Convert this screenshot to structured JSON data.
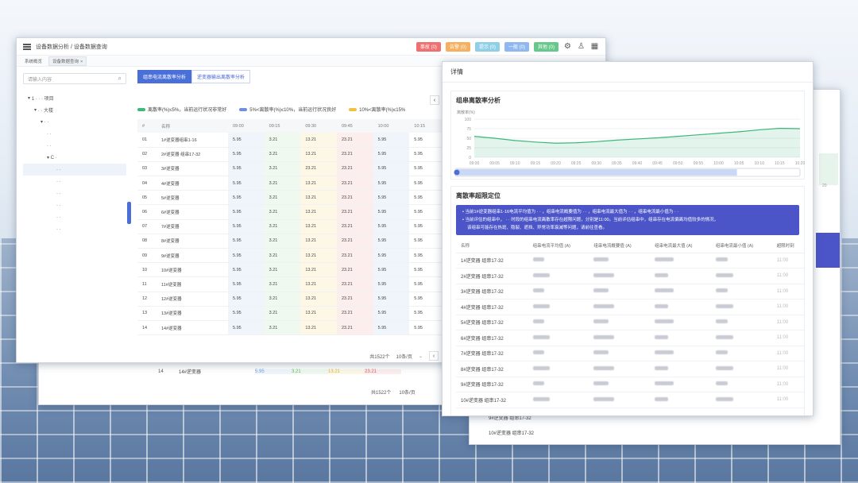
{
  "main": {
    "breadcrumb": "设备数据分析 / 设备数据查询",
    "tabs": [
      {
        "label": "系统概览"
      },
      {
        "label": "设备数据查询"
      }
    ],
    "status_chips": [
      {
        "label": "事故 (0)",
        "color": "#f07070"
      },
      {
        "label": "告警 (0)",
        "color": "#f5b060"
      },
      {
        "label": "提示 (0)",
        "color": "#8fd0e8"
      },
      {
        "label": "一般 (0)",
        "color": "#8fb8f0"
      },
      {
        "label": "其他 (0)",
        "color": "#66c88a"
      }
    ],
    "header_icons": [
      "settings-icon",
      "user-icon",
      "grid-icon"
    ],
    "search_placeholder": "请输入内容",
    "tree": [
      {
        "label": "1 · · · 项目",
        "indent": 0
      },
      {
        "label": "· · 大楼",
        "indent": 1
      },
      {
        "label": "· ·",
        "indent": 2
      },
      {
        "label": "· ·",
        "indent": 3
      },
      {
        "label": "· ·",
        "indent": 3
      },
      {
        "label": "C ·",
        "indent": 3
      },
      {
        "label": "· ·",
        "indent": 4
      },
      {
        "label": "· ·",
        "indent": 4
      },
      {
        "label": "· ·",
        "indent": 4
      },
      {
        "label": "· ·",
        "indent": 4
      },
      {
        "label": "· ·",
        "indent": 4
      },
      {
        "label": "· ·",
        "indent": 4
      }
    ],
    "content_tabs": [
      {
        "label": "组串电流离散率分析"
      },
      {
        "label": "逆变器输出离散率分析"
      }
    ],
    "legend": [
      {
        "label": "离散率(%)≤5%，当前运行状况非常好",
        "color": "#3cb878"
      },
      {
        "label": "5%<离散率(%)≤10%，当前运行状况良好",
        "color": "#6d8fe0"
      },
      {
        "label": "10%<离散率(%)≤15%",
        "color": "#f0c040"
      }
    ],
    "columns": [
      "#",
      "名称",
      "09:00",
      "09:15",
      "09:30",
      "09:45",
      "10:00",
      "10:15"
    ],
    "rows": [
      {
        "idx": "01",
        "name": "1#逆变器组串1-16",
        "v": [
          "5.95",
          "3.21",
          "13.21",
          "23.21",
          "5.95",
          "5.95"
        ]
      },
      {
        "idx": "02",
        "name": "2#逆变器 组串17-32",
        "v": [
          "5.95",
          "3.21",
          "13.21",
          "23.21",
          "5.95",
          "5.95"
        ]
      },
      {
        "idx": "03",
        "name": "3#逆变器",
        "v": [
          "5.95",
          "3.21",
          "23.21",
          "23.21",
          "5.95",
          "5.95"
        ]
      },
      {
        "idx": "04",
        "name": "4#逆变器",
        "v": [
          "5.95",
          "3.21",
          "13.21",
          "23.21",
          "5.95",
          "5.95"
        ]
      },
      {
        "idx": "05",
        "name": "5#逆变器",
        "v": [
          "5.95",
          "3.21",
          "13.21",
          "23.21",
          "5.95",
          "5.95"
        ]
      },
      {
        "idx": "06",
        "name": "6#逆变器",
        "v": [
          "5.95",
          "3.21",
          "13.21",
          "23.21",
          "5.95",
          "5.95"
        ]
      },
      {
        "idx": "07",
        "name": "7#逆变器",
        "v": [
          "5.95",
          "3.21",
          "13.21",
          "23.21",
          "5.95",
          "5.95"
        ]
      },
      {
        "idx": "08",
        "name": "8#逆变器",
        "v": [
          "5.95",
          "3.21",
          "13.21",
          "23.21",
          "5.95",
          "5.95"
        ]
      },
      {
        "idx": "09",
        "name": "9#逆变器",
        "v": [
          "5.95",
          "3.21",
          "13.21",
          "23.21",
          "5.95",
          "5.95"
        ]
      },
      {
        "idx": "10",
        "name": "10#逆变器",
        "v": [
          "5.95",
          "3.21",
          "13.21",
          "23.21",
          "5.95",
          "5.95"
        ]
      },
      {
        "idx": "11",
        "name": "11#逆变器",
        "v": [
          "5.95",
          "3.21",
          "13.21",
          "23.21",
          "5.95",
          "5.95"
        ]
      },
      {
        "idx": "12",
        "name": "12#逆变器",
        "v": [
          "5.95",
          "3.21",
          "13.21",
          "23.21",
          "5.95",
          "5.95"
        ]
      },
      {
        "idx": "13",
        "name": "13#逆变器",
        "v": [
          "5.95",
          "3.21",
          "13.21",
          "23.21",
          "5.95",
          "5.95"
        ]
      },
      {
        "idx": "14",
        "name": "14#逆变器",
        "v": [
          "5.95",
          "3.21",
          "13.21",
          "23.21",
          "5.95",
          "5.95"
        ]
      }
    ],
    "cell_classes": [
      "c-blue",
      "c-green",
      "c-yellow",
      "c-red",
      "c-blue",
      "c-gray"
    ],
    "total": "共1522个",
    "page_size": "10条/页",
    "current_page": "1",
    "prev_label": "‹"
  },
  "back_left": {
    "row": {
      "idx": "14",
      "name": "14#逆变器",
      "v": [
        "5.95",
        "3.21",
        "13.21",
        "23.21"
      ]
    },
    "total": "共1522个",
    "page_size": "10条/页"
  },
  "detail": {
    "title": "详情",
    "chart_title": "组串离散率分析",
    "chart_data": {
      "type": "area",
      "ylabel": "离散率(%)",
      "yticks": [
        "100",
        "75",
        "50",
        "25",
        "0"
      ],
      "ylim": [
        0,
        100
      ],
      "x": [
        "09:00",
        "09:05",
        "09:10",
        "09:15",
        "09:20",
        "09:25",
        "09:30",
        "09:35",
        "09:40",
        "09:45",
        "09:50",
        "09:55",
        "10:00",
        "10:05",
        "10:10",
        "10:15",
        "10:20"
      ],
      "values": [
        55,
        50,
        44,
        40,
        37,
        38,
        41,
        45,
        48,
        51,
        55,
        59,
        63,
        67,
        72,
        76,
        75
      ],
      "color": "#3cb878"
    },
    "slider": {
      "value": 0.82
    },
    "locate_title": "离散率超限定位",
    "info_lines": [
      "当前1#逆变器组串1-16电流平均值为 · · ，组串电流概要值为 · · ，组串电流最大值为 · · ，组串电流最小值为 · ·",
      "当前评估的组串中， · · 时段的组串电流离散率存在超限问题，分别是11:00。当前评估组串中，组串存在电流偏离均值较多的情况，",
      "该组串可能存在热斑、隐裂、遮挡、异常功率衰减等问题，请前往查看。"
    ],
    "columns": [
      "名称",
      "组串电流平均值 (A)",
      "组串电流概要值 (A)",
      "组串电流最大值 (A)",
      "组串电流最小值 (A)",
      "超限时刻"
    ],
    "rows": [
      "1#逆变器 组串17-32",
      "2#逆变器 组串17-32",
      "3#逆变器 组串17-32",
      "4#逆变器 组串17-32",
      "5#逆变器 组串17-32",
      "6#逆变器 组串17-32",
      "7#逆变器 组串17-32",
      "8#逆变器 组串17-32",
      "9#逆变器 组串17-32",
      "10#逆变器 组串17-32"
    ],
    "cell_times": [
      "11:00",
      "11:00",
      "11:00",
      "11:00",
      "11:00",
      "11:00",
      "11:00",
      "11:00",
      "11:00",
      "11:00"
    ]
  },
  "back_right": {
    "rows": [
      "9#逆变器 组串17-32",
      "10#逆变器 组串17-32"
    ],
    "tick": "20"
  }
}
